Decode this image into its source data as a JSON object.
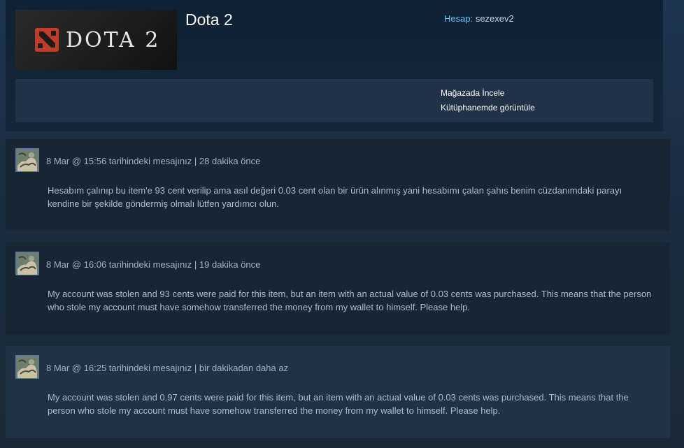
{
  "game": {
    "logo_text": "DOTA 2",
    "title": "Dota 2"
  },
  "account": {
    "label": "Hesap:",
    "name": "sezexev2"
  },
  "links": {
    "store": "Mağazada İncele",
    "library": "Kütüphanemde görüntüle"
  },
  "messages": [
    {
      "meta": "8 Mar @ 15:56 tarihindeki mesajınız | 28 dakika önce",
      "text": "Hesabım çalınıp bu item'e 93 cent verilip ama asıl değeri 0.03 cent olan bir ürün alınmış yani hesabımı çalan şahıs benim cüzdanımdaki parayı kendine bir şekilde göndermiş olmalı lütfen yardımcı olun."
    },
    {
      "meta": "8 Mar @ 16:06 tarihindeki mesajınız | 19 dakika önce",
      "text": "My account was stolen and 93 cents were paid for this item, but an item with an actual value of 0.03 cents was purchased. This means that the person who stole my account must have somehow transferred the money from my wallet to himself. Please help."
    },
    {
      "meta": "8 Mar @ 16:25 tarihindeki mesajınız | bir dakikadan daha az",
      "text": "My account was stolen and 0.97 cents were paid for this item, but an item with an actual value of 0.03 cents was purchased. This means that the person who stole my account must have somehow transferred the money from my wallet to himself. Please help."
    }
  ],
  "colors": {
    "accent": "#66c0f4",
    "logo_red": "#c23c2a"
  }
}
